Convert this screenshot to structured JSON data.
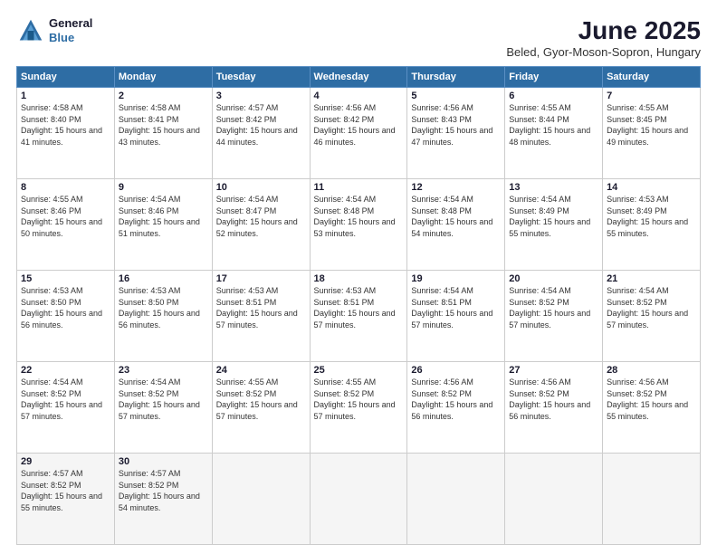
{
  "logo": {
    "line1": "General",
    "line2": "Blue"
  },
  "title": "June 2025",
  "subtitle": "Beled, Gyor-Moson-Sopron, Hungary",
  "days": [
    "Sunday",
    "Monday",
    "Tuesday",
    "Wednesday",
    "Thursday",
    "Friday",
    "Saturday"
  ],
  "weeks": [
    [
      {
        "num": "1",
        "rise": "4:58 AM",
        "set": "8:40 PM",
        "daylight": "15 hours and 41 minutes."
      },
      {
        "num": "2",
        "rise": "4:58 AM",
        "set": "8:41 PM",
        "daylight": "15 hours and 43 minutes."
      },
      {
        "num": "3",
        "rise": "4:57 AM",
        "set": "8:42 PM",
        "daylight": "15 hours and 44 minutes."
      },
      {
        "num": "4",
        "rise": "4:56 AM",
        "set": "8:42 PM",
        "daylight": "15 hours and 46 minutes."
      },
      {
        "num": "5",
        "rise": "4:56 AM",
        "set": "8:43 PM",
        "daylight": "15 hours and 47 minutes."
      },
      {
        "num": "6",
        "rise": "4:55 AM",
        "set": "8:44 PM",
        "daylight": "15 hours and 48 minutes."
      },
      {
        "num": "7",
        "rise": "4:55 AM",
        "set": "8:45 PM",
        "daylight": "15 hours and 49 minutes."
      }
    ],
    [
      {
        "num": "8",
        "rise": "4:55 AM",
        "set": "8:46 PM",
        "daylight": "15 hours and 50 minutes."
      },
      {
        "num": "9",
        "rise": "4:54 AM",
        "set": "8:46 PM",
        "daylight": "15 hours and 51 minutes."
      },
      {
        "num": "10",
        "rise": "4:54 AM",
        "set": "8:47 PM",
        "daylight": "15 hours and 52 minutes."
      },
      {
        "num": "11",
        "rise": "4:54 AM",
        "set": "8:48 PM",
        "daylight": "15 hours and 53 minutes."
      },
      {
        "num": "12",
        "rise": "4:54 AM",
        "set": "8:48 PM",
        "daylight": "15 hours and 54 minutes."
      },
      {
        "num": "13",
        "rise": "4:54 AM",
        "set": "8:49 PM",
        "daylight": "15 hours and 55 minutes."
      },
      {
        "num": "14",
        "rise": "4:53 AM",
        "set": "8:49 PM",
        "daylight": "15 hours and 55 minutes."
      }
    ],
    [
      {
        "num": "15",
        "rise": "4:53 AM",
        "set": "8:50 PM",
        "daylight": "15 hours and 56 minutes."
      },
      {
        "num": "16",
        "rise": "4:53 AM",
        "set": "8:50 PM",
        "daylight": "15 hours and 56 minutes."
      },
      {
        "num": "17",
        "rise": "4:53 AM",
        "set": "8:51 PM",
        "daylight": "15 hours and 57 minutes."
      },
      {
        "num": "18",
        "rise": "4:53 AM",
        "set": "8:51 PM",
        "daylight": "15 hours and 57 minutes."
      },
      {
        "num": "19",
        "rise": "4:54 AM",
        "set": "8:51 PM",
        "daylight": "15 hours and 57 minutes."
      },
      {
        "num": "20",
        "rise": "4:54 AM",
        "set": "8:52 PM",
        "daylight": "15 hours and 57 minutes."
      },
      {
        "num": "21",
        "rise": "4:54 AM",
        "set": "8:52 PM",
        "daylight": "15 hours and 57 minutes."
      }
    ],
    [
      {
        "num": "22",
        "rise": "4:54 AM",
        "set": "8:52 PM",
        "daylight": "15 hours and 57 minutes."
      },
      {
        "num": "23",
        "rise": "4:54 AM",
        "set": "8:52 PM",
        "daylight": "15 hours and 57 minutes."
      },
      {
        "num": "24",
        "rise": "4:55 AM",
        "set": "8:52 PM",
        "daylight": "15 hours and 57 minutes."
      },
      {
        "num": "25",
        "rise": "4:55 AM",
        "set": "8:52 PM",
        "daylight": "15 hours and 57 minutes."
      },
      {
        "num": "26",
        "rise": "4:56 AM",
        "set": "8:52 PM",
        "daylight": "15 hours and 56 minutes."
      },
      {
        "num": "27",
        "rise": "4:56 AM",
        "set": "8:52 PM",
        "daylight": "15 hours and 56 minutes."
      },
      {
        "num": "28",
        "rise": "4:56 AM",
        "set": "8:52 PM",
        "daylight": "15 hours and 55 minutes."
      }
    ],
    [
      {
        "num": "29",
        "rise": "4:57 AM",
        "set": "8:52 PM",
        "daylight": "15 hours and 55 minutes."
      },
      {
        "num": "30",
        "rise": "4:57 AM",
        "set": "8:52 PM",
        "daylight": "15 hours and 54 minutes."
      },
      null,
      null,
      null,
      null,
      null
    ]
  ]
}
